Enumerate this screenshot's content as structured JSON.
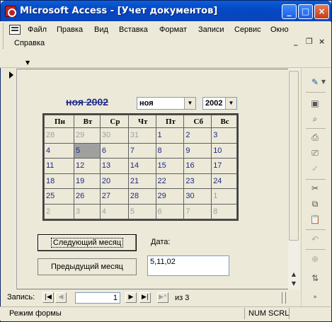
{
  "window": {
    "title": "Microsoft Access - [Учет документов]",
    "controls": {
      "minimize": "_",
      "maximize": "□",
      "close": "×"
    }
  },
  "menubar": {
    "items": [
      "Файл",
      "Правка",
      "Вид",
      "Вставка",
      "Формат",
      "Записи",
      "Сервис",
      "Окно",
      "Справка"
    ],
    "mdi_controls": {
      "minimize": "_",
      "restore": "❐",
      "close": "×"
    }
  },
  "form": {
    "month_title": "ноя 2002",
    "month_combo": "ноя",
    "year_combo": "2002",
    "weekdays": [
      "Пн",
      "Вт",
      "Ср",
      "Чт",
      "Пт",
      "Сб",
      "Вс"
    ],
    "weeks": [
      [
        "28",
        "29",
        "30",
        "31",
        "1",
        "2",
        "3"
      ],
      [
        "4",
        "5",
        "6",
        "7",
        "8",
        "9",
        "10"
      ],
      [
        "11",
        "12",
        "13",
        "14",
        "15",
        "16",
        "17"
      ],
      [
        "18",
        "19",
        "20",
        "21",
        "22",
        "23",
        "24"
      ],
      [
        "25",
        "26",
        "27",
        "28",
        "29",
        "30",
        "1"
      ],
      [
        "2",
        "3",
        "4",
        "5",
        "6",
        "7",
        "8"
      ]
    ],
    "next_month_button": "Следующий месяц",
    "prev_month_button": "Предыдущий месяц",
    "date_label": "Дата:",
    "date_value": "5,11,02"
  },
  "navigation": {
    "label": "Запись:",
    "current_record": "1",
    "of_label": "из  3",
    "first": "|◀",
    "prev": "◀",
    "next": "▶",
    "last": "▶|",
    "new": "▶*"
  },
  "statusbar": {
    "mode": "Режим формы",
    "num": "NUM",
    "scrl": "SCRL"
  },
  "right_toolbar_icons": [
    "design-view-icon",
    "save-icon",
    "search-icon",
    "print-icon",
    "print-preview-icon",
    "spelling-icon",
    "cut-icon",
    "copy-icon",
    "paste-icon",
    "undo-icon",
    "hyperlink-icon",
    "sort-ascending-icon"
  ]
}
